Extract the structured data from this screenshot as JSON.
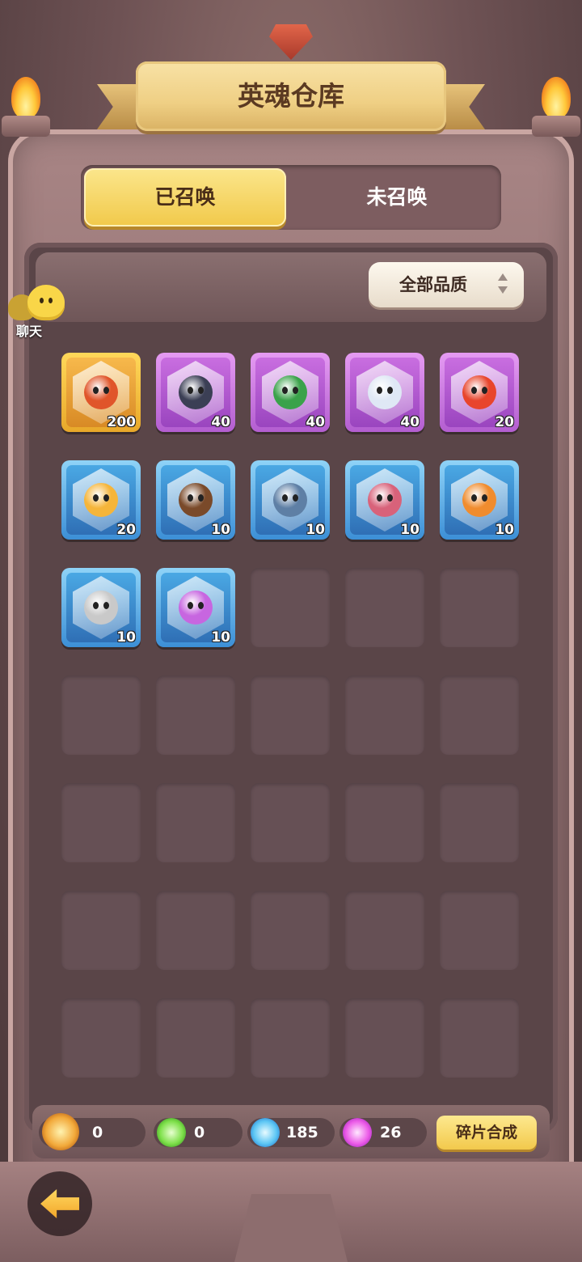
{
  "header": {
    "title": "英魂仓库"
  },
  "tabs": [
    {
      "label": "已召唤",
      "active": true
    },
    {
      "label": "未召唤",
      "active": false
    }
  ],
  "filter": {
    "selected": "全部品质"
  },
  "chat": {
    "label": "聊天"
  },
  "heroes": [
    {
      "rarity": "gold",
      "count": "200",
      "color": "#e0552a"
    },
    {
      "rarity": "purple",
      "count": "40",
      "color": "#3b3f55"
    },
    {
      "rarity": "purple",
      "count": "40",
      "color": "#3aa24a"
    },
    {
      "rarity": "purple",
      "count": "40",
      "color": "#dfe8f5"
    },
    {
      "rarity": "purple",
      "count": "20",
      "color": "#e8452c"
    },
    {
      "rarity": "blue",
      "count": "20",
      "color": "#f5b53a"
    },
    {
      "rarity": "blue",
      "count": "10",
      "color": "#7a4a2a"
    },
    {
      "rarity": "blue",
      "count": "10",
      "color": "#5e7fa5"
    },
    {
      "rarity": "blue",
      "count": "10",
      "color": "#d8627a"
    },
    {
      "rarity": "blue",
      "count": "10",
      "color": "#f08c2e"
    },
    {
      "rarity": "blue",
      "count": "10",
      "color": "#c9c9c9"
    },
    {
      "rarity": "blue",
      "count": "10",
      "color": "#c766e0"
    }
  ],
  "grid": {
    "columns": 5,
    "rows": 7
  },
  "resources": {
    "gold_fragment": "0",
    "green_fragment": "0",
    "blue_fragment": "185",
    "purple_fragment": "26"
  },
  "compose_button": {
    "label": "碎片合成"
  }
}
